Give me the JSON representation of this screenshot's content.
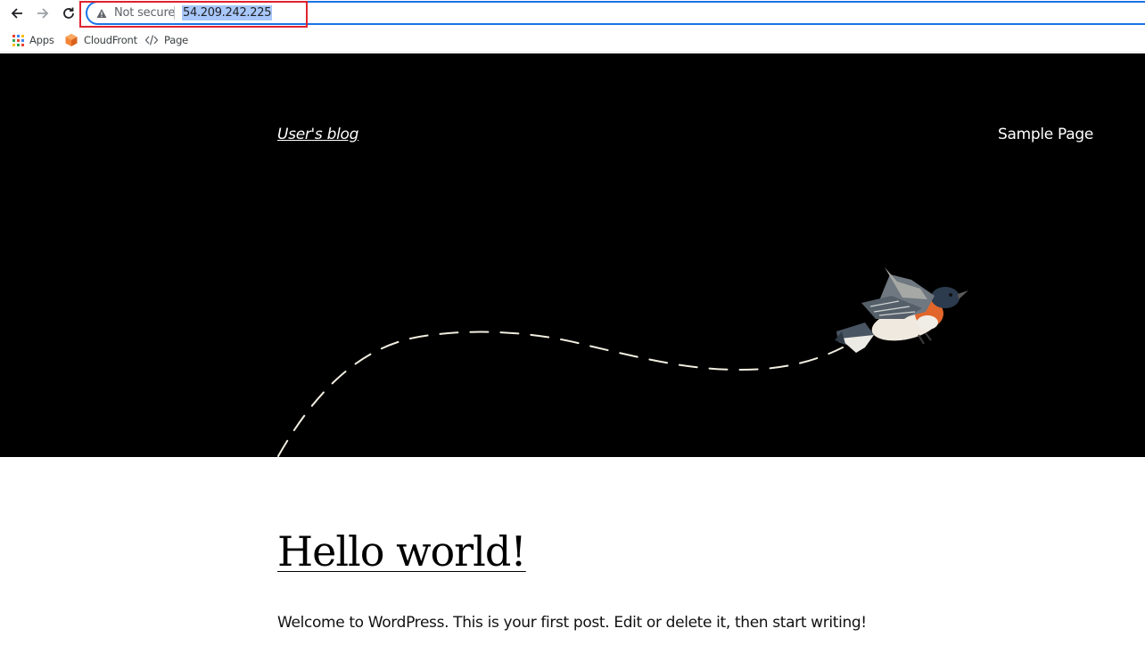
{
  "browser": {
    "security_label": "Not secure",
    "url": "54.209.242.225",
    "bookmarks": [
      {
        "label": "Apps",
        "icon": "apps-grid-icon"
      },
      {
        "label": "CloudFront",
        "icon": "cloudfront-icon"
      },
      {
        "label": "Page",
        "icon": "code-icon"
      }
    ],
    "accent_color": "#1a73e8",
    "highlight_color": "#e0232e"
  },
  "site": {
    "title": "User's blog",
    "nav": [
      "Sample Page"
    ],
    "hero_background": "#000000"
  },
  "post": {
    "title": "Hello world!",
    "excerpt": "Welcome to WordPress. This is your first post. Edit or delete it, then start writing!"
  }
}
